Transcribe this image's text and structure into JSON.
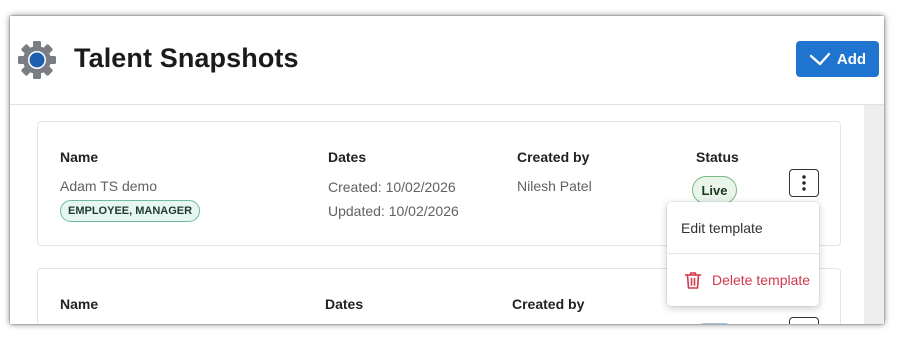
{
  "header": {
    "title": "Talent Snapshots",
    "settings_icon": "gear-icon",
    "add_button": {
      "label": "Add",
      "icon": "check-icon"
    }
  },
  "columns": {
    "name": "Name",
    "dates": "Dates",
    "created_by": "Created by",
    "status": "Status"
  },
  "templates": [
    {
      "name": "Adam TS demo",
      "tag": "EMPLOYEE, MANAGER",
      "created": "Created: 10/02/2026",
      "updated": "Updated: 10/02/2026",
      "created_by": "Nilesh Patel",
      "status": "Live"
    }
  ],
  "actions_menu": {
    "edit": "Edit template",
    "delete": "Delete template",
    "delete_icon": "trash-icon"
  },
  "colors": {
    "primary": "#1f74cf",
    "danger": "#d1384a",
    "live_badge_bg": "#e9f5ea",
    "tag_bg": "#e8f6f2"
  }
}
